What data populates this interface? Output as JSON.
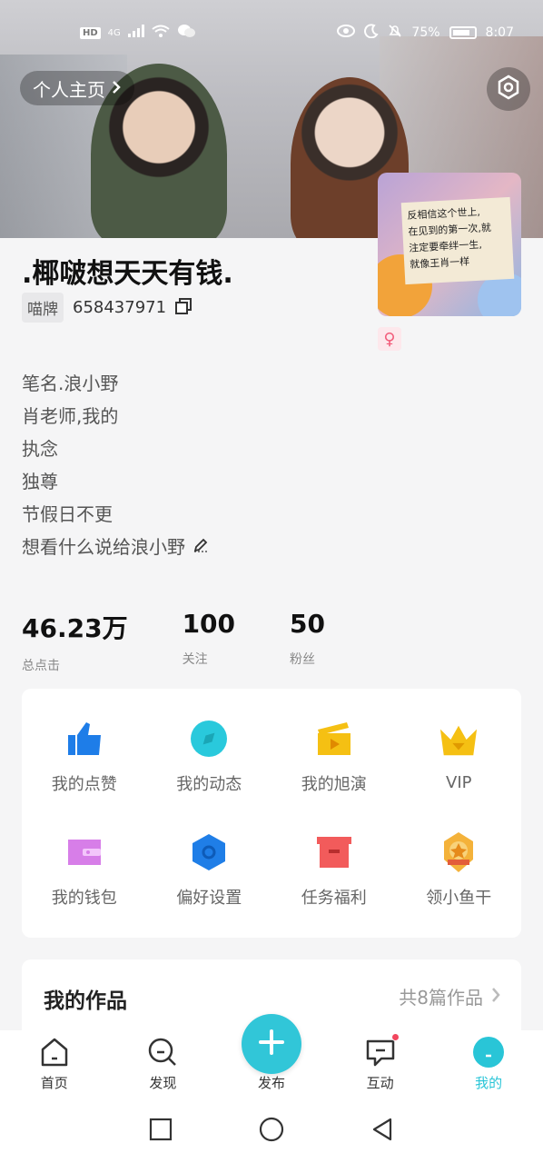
{
  "status_bar": {
    "left_badges": [
      "HD",
      "4G"
    ],
    "battery": "75%",
    "time": "8:07"
  },
  "header": {
    "homepage_link": "个人主页"
  },
  "avatar_note": [
    "反相信这个世上,",
    "在见到的第一次,就",
    "注定要牵绊一生,",
    "就像王肖一样"
  ],
  "profile": {
    "username": ".椰啵想天天有钱.",
    "id_tag": "喵牌",
    "id_number": "658437971",
    "gender": "♀",
    "bio": [
      "笔名.浪小野",
      "肖老师,我的",
      "执念",
      "独尊",
      "节假日不更",
      "想看什么说给浪小野"
    ]
  },
  "stats": [
    {
      "value": "46.23万",
      "label": "总点击"
    },
    {
      "value": "100",
      "label": "关注"
    },
    {
      "value": "50",
      "label": "粉丝"
    }
  ],
  "menu": [
    {
      "label": "我的点赞",
      "icon": "thumbs-up-icon",
      "color": "#1e7de8"
    },
    {
      "label": "我的动态",
      "icon": "compass-icon",
      "color": "#29c9dc"
    },
    {
      "label": "我的旭演",
      "icon": "clapper-icon",
      "color": "#f5c013"
    },
    {
      "label": "VIP",
      "icon": "crown-icon",
      "color": "#f5c013"
    },
    {
      "label": "我的钱包",
      "icon": "wallet-icon",
      "color": "#d77ee8"
    },
    {
      "label": "偏好设置",
      "icon": "hexagon-settings-icon",
      "color": "#1f7ee7"
    },
    {
      "label": "任务福利",
      "icon": "gift-box-icon",
      "color": "#f25b5b"
    },
    {
      "label": "领小鱼干",
      "icon": "medal-icon",
      "color": "#f4b23a"
    }
  ],
  "works": {
    "title": "我的作品",
    "count": "共8篇作品"
  },
  "bottom_nav": [
    {
      "label": "首页",
      "icon": "home-icon"
    },
    {
      "label": "发现",
      "icon": "search-icon"
    },
    {
      "label": "发布",
      "icon": "plus-icon"
    },
    {
      "label": "互动",
      "icon": "message-icon"
    },
    {
      "label": "我的",
      "icon": "profile-icon"
    }
  ],
  "colors": {
    "accent": "#29c5d7",
    "background": "#f5f5f6",
    "notification": "#f2465e"
  }
}
